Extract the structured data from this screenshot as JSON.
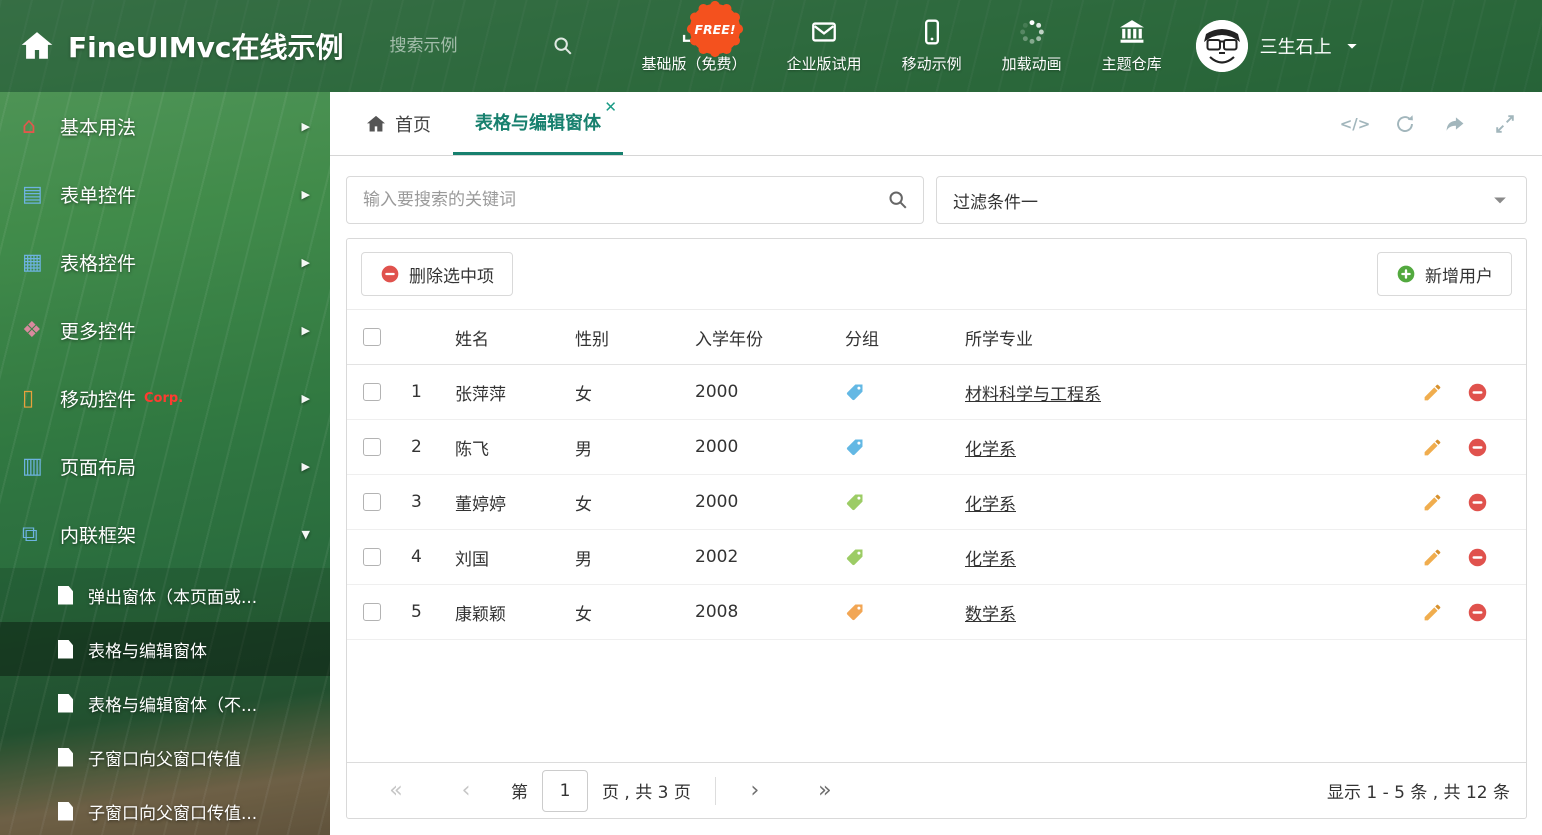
{
  "header": {
    "title": "FineUIMvc在线示例",
    "search": {
      "placeholder": "搜索示例"
    },
    "free_badge": "FREE!",
    "nav": [
      {
        "label": "基础版（免费）",
        "icon": "download-icon"
      },
      {
        "label": "企业版试用",
        "icon": "mail-icon"
      },
      {
        "label": "移动示例",
        "icon": "mobile-icon"
      },
      {
        "label": "加载动画",
        "icon": "spinner-icon"
      },
      {
        "label": "主题仓库",
        "icon": "bank-icon"
      }
    ],
    "user": {
      "name": "三生石上"
    }
  },
  "sidebar": {
    "menu": [
      {
        "label": "基本用法",
        "icon": "home-icon",
        "icon_color": "#e2574c"
      },
      {
        "label": "表单控件",
        "icon": "form-icon",
        "icon_color": "#6db3e0"
      },
      {
        "label": "表格控件",
        "icon": "grid-icon",
        "icon_color": "#6db3e0"
      },
      {
        "label": "更多控件",
        "icon": "shapes-icon",
        "icon_color": "#d98a9e"
      },
      {
        "label": "移动控件",
        "badge": "Corp.",
        "icon": "mobile-icon",
        "icon_color": "#e8a13c"
      },
      {
        "label": "页面布局",
        "icon": "layout-icon",
        "icon_color": "#6db3e0"
      },
      {
        "label": "内联框架",
        "icon": "frame-icon",
        "icon_color": "#6db3e0",
        "expanded": true
      }
    ],
    "submenu": [
      {
        "label": "弹出窗体（本页面或..."
      },
      {
        "label": "表格与编辑窗体",
        "active": true
      },
      {
        "label": "表格与编辑窗体（不..."
      },
      {
        "label": "子窗口向父窗口传值"
      },
      {
        "label": "子窗口向父窗口传值..."
      }
    ]
  },
  "tabs": {
    "home": "首页",
    "active": "表格与编辑窗体"
  },
  "filters": {
    "search_placeholder": "输入要搜索的关键词",
    "filter_selected": "过滤条件一"
  },
  "toolbar": {
    "delete_label": "删除选中项",
    "add_label": "新增用户"
  },
  "table": {
    "columns": [
      "姓名",
      "性别",
      "入学年份",
      "分组",
      "所学专业"
    ],
    "rows": [
      {
        "index": "1",
        "name": "张萍萍",
        "gender": "女",
        "year": "2000",
        "tag_color": "#63b8e4",
        "major": "材料科学与工程系"
      },
      {
        "index": "2",
        "name": "陈飞",
        "gender": "男",
        "year": "2000",
        "tag_color": "#63b8e4",
        "major": "化学系"
      },
      {
        "index": "3",
        "name": "董婷婷",
        "gender": "女",
        "year": "2000",
        "tag_color": "#9ccc65",
        "major": "化学系"
      },
      {
        "index": "4",
        "name": "刘国",
        "gender": "男",
        "year": "2002",
        "tag_color": "#9ccc65",
        "major": "化学系"
      },
      {
        "index": "5",
        "name": "康颖颖",
        "gender": "女",
        "year": "2008",
        "tag_color": "#f2a654",
        "major": "数学系"
      }
    ]
  },
  "pagination": {
    "label_page": "第",
    "current": "1",
    "label_total": "页 , 共 3 页",
    "summary": "显示 1 - 5 条 , 共 12 条"
  }
}
